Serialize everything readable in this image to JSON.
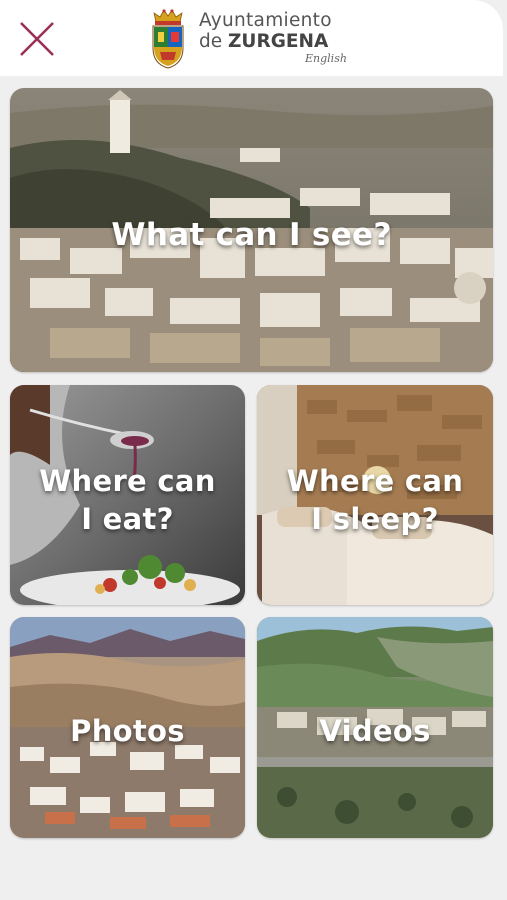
{
  "header": {
    "close_icon": "close-icon",
    "logo_icon": "coat-of-arms-icon",
    "brand_line1": "Ayuntamiento",
    "brand_line2_prefix": "de ",
    "brand_line2_bold": "ZURGENA",
    "language": "English",
    "accent_color": "#9c2f58"
  },
  "tiles": {
    "see": "What can I see?",
    "eat_line1": "Where can",
    "eat_line2": "I eat?",
    "sleep_line1": "Where can",
    "sleep_line2": "I sleep?",
    "photos": "Photos",
    "videos": "Videos"
  }
}
